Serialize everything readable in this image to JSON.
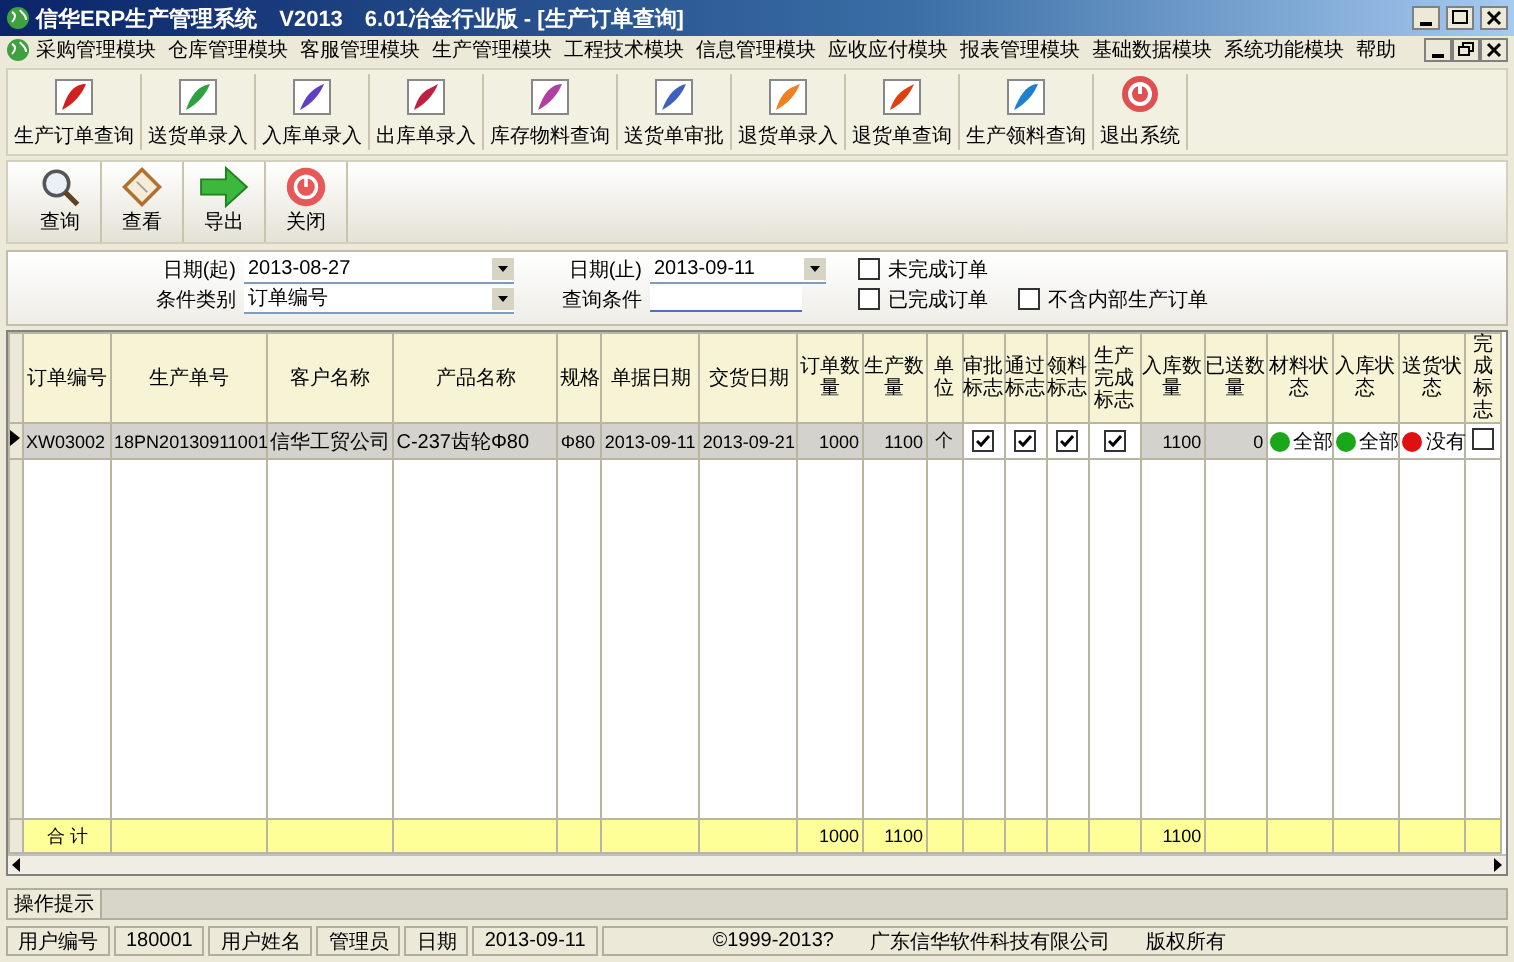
{
  "window": {
    "title": "信华ERP生产管理系统　V2013　6.01冶金行业版 - [生产订单查询]"
  },
  "menu": [
    "采购管理模块",
    "仓库管理模块",
    "客服管理模块",
    "生产管理模块",
    "工程技术模块",
    "信息管理模块",
    "应收应付模块",
    "报表管理模块",
    "基础数据模块",
    "系统功能模块",
    "帮助"
  ],
  "main_toolbar": [
    {
      "label": "生产订单查询"
    },
    {
      "label": "送货单录入"
    },
    {
      "label": "入库单录入"
    },
    {
      "label": "出库单录入"
    },
    {
      "label": "库存物料查询"
    },
    {
      "label": "送货单审批"
    },
    {
      "label": "退货单录入"
    },
    {
      "label": "退货单查询"
    },
    {
      "label": "生产领料查询"
    },
    {
      "label": "退出系统"
    }
  ],
  "toolbar": [
    {
      "label": "查询"
    },
    {
      "label": "查看"
    },
    {
      "label": "导出"
    },
    {
      "label": "关闭"
    }
  ],
  "filter": {
    "date_from": {
      "label": "日期(起)",
      "value": "2013-08-27"
    },
    "date_to": {
      "label": "日期(止)",
      "value": "2013-09-11"
    },
    "condition_type": {
      "label": "条件类别",
      "value": "订单编号"
    },
    "query": {
      "label": "查询条件"
    },
    "checkboxes": [
      {
        "label": "未完成订单",
        "checked": false
      },
      {
        "label": "已完成订单",
        "checked": false
      },
      {
        "label": "不含内部生产订单",
        "checked": false
      }
    ]
  },
  "table": {
    "columns": [
      {
        "label": "订单编号"
      },
      {
        "label": "生产单号"
      },
      {
        "label": "客户名称"
      },
      {
        "label": "产品名称"
      },
      {
        "label": "规格"
      },
      {
        "label": "单据日期"
      },
      {
        "label": "交货日期"
      },
      {
        "label": "订单数量"
      },
      {
        "label": "生产数量"
      },
      {
        "label": "单位"
      },
      {
        "label": "审批标志"
      },
      {
        "label": "通过标志"
      },
      {
        "label": "领料标志"
      },
      {
        "label": "生产完成标志"
      },
      {
        "label": "入库数量"
      },
      {
        "label": "已送数量"
      },
      {
        "label": "材料状态"
      },
      {
        "label": "入库状态"
      },
      {
        "label": "送货状态"
      },
      {
        "label": "完成标志"
      }
    ],
    "rows": [
      {
        "selected": true,
        "cells": [
          {
            "kind": "text",
            "text": "XW03002"
          },
          {
            "kind": "text",
            "text": "18PN20130911001"
          },
          {
            "kind": "text",
            "text": "信华工贸公司"
          },
          {
            "kind": "text",
            "text": "C-237齿轮Φ80"
          },
          {
            "kind": "text",
            "text": "Φ80"
          },
          {
            "kind": "text",
            "text": "2013-09-11"
          },
          {
            "kind": "text",
            "text": "2013-09-21"
          },
          {
            "kind": "number",
            "text": "1000"
          },
          {
            "kind": "number",
            "text": "1100"
          },
          {
            "kind": "center",
            "text": "个"
          },
          {
            "kind": "check",
            "checked": true
          },
          {
            "kind": "check",
            "checked": true
          },
          {
            "kind": "check",
            "checked": true
          },
          {
            "kind": "check",
            "checked": true
          },
          {
            "kind": "number",
            "text": "1100"
          },
          {
            "kind": "number",
            "text": "0"
          },
          {
            "kind": "status",
            "color": "#1aa81a",
            "text": "全部"
          },
          {
            "kind": "status",
            "color": "#1aa81a",
            "text": "全部"
          },
          {
            "kind": "status",
            "color": "#e01010",
            "text": "没有"
          },
          {
            "kind": "check",
            "checked": false
          }
        ]
      }
    ],
    "totals": {
      "label": "合 计",
      "order_qty": "1000",
      "production_qty": "1100",
      "stock_in_qty": "1100"
    }
  },
  "hint": {
    "label": "操作提示"
  },
  "status_bar": [
    "用户编号",
    "180001",
    "用户姓名",
    "管理员",
    "日期",
    "2013-09-11"
  ],
  "copyright": [
    "©1999-2013?",
    "广东信华软件科技有限公司",
    "版权所有"
  ]
}
